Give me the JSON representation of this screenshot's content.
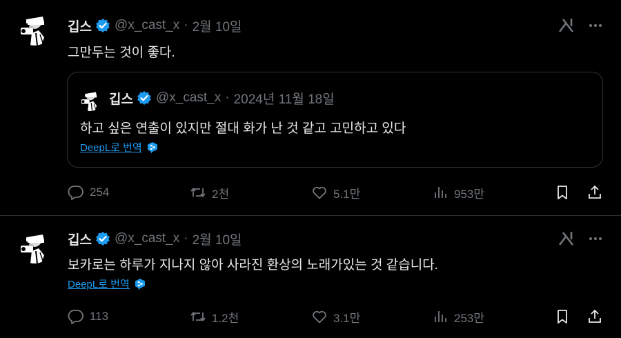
{
  "tweets": [
    {
      "author": {
        "name": "깁스",
        "handle": "@x_cast_x",
        "date": "2월 10일"
      },
      "text": "그만두는 것이 좋다.",
      "quote": {
        "author": {
          "name": "깁스",
          "handle": "@x_cast_x",
          "date": "2024년 11월 18일"
        },
        "text": "하고 싶은 연출이 있지만 절대 화가 난 것 같고 고민하고 있다",
        "translate_label": "DeepL로 번역"
      },
      "stats": {
        "replies": "254",
        "reposts": "2천",
        "likes": "5.1만",
        "views": "953만"
      }
    },
    {
      "author": {
        "name": "깁스",
        "handle": "@x_cast_x",
        "date": "2월 10일"
      },
      "text": "보카로는 하루가 지나지 않아 사라진 환상의 노래가있는 것 같습니다.",
      "translate_label": "DeepL로 번역",
      "stats": {
        "replies": "113",
        "reposts": "1.2천",
        "likes": "3.1만",
        "views": "253만"
      }
    }
  ],
  "separator": "·",
  "colors": {
    "background": "#000000",
    "text": "#e7e9ea",
    "muted": "#71767b",
    "accent": "#1d9bf0",
    "border": "#2f3336"
  },
  "icons": [
    "verified-badge-icon",
    "grok-icon",
    "more-icon",
    "deepl-icon",
    "reply-icon",
    "repost-icon",
    "like-icon",
    "views-icon",
    "bookmark-icon",
    "share-icon"
  ]
}
